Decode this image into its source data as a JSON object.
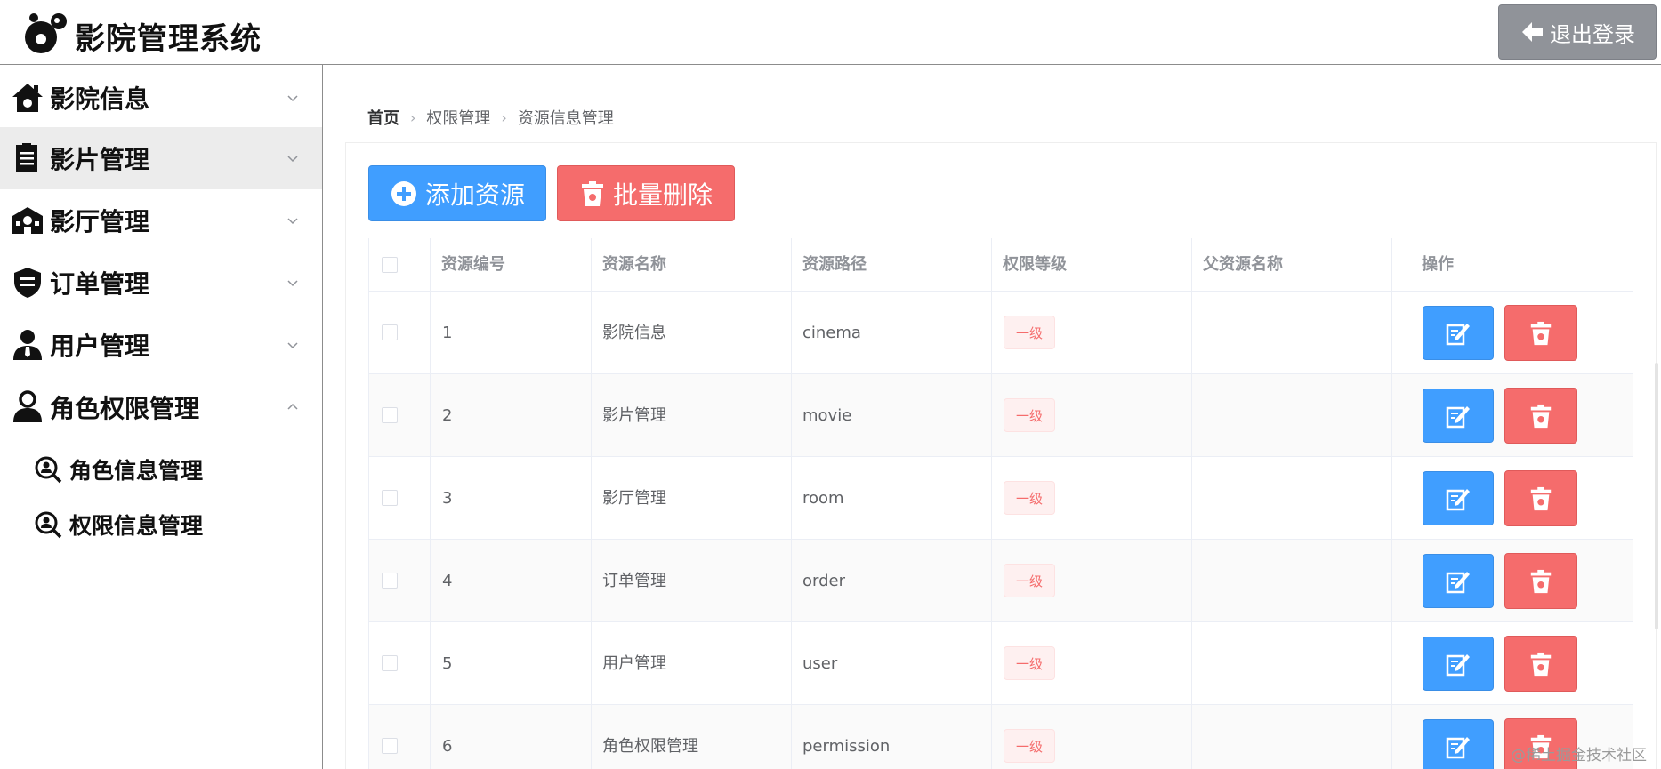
{
  "header": {
    "title": "影院管理系统",
    "logout_label": "退出登录"
  },
  "sidebar": {
    "items": [
      {
        "label": "影院信息",
        "icon": "house-icon",
        "expanded": false
      },
      {
        "label": "影片管理",
        "icon": "clipboard-icon",
        "expanded": false,
        "active": true
      },
      {
        "label": "影厅管理",
        "icon": "building-icon",
        "expanded": false
      },
      {
        "label": "订单管理",
        "icon": "shield-icon",
        "expanded": false
      },
      {
        "label": "用户管理",
        "icon": "user-tie-icon",
        "expanded": false
      },
      {
        "label": "角色权限管理",
        "icon": "user-icon",
        "expanded": true
      }
    ],
    "subitems": [
      {
        "label": "角色信息管理",
        "icon": "search-user-icon"
      },
      {
        "label": "权限信息管理",
        "icon": "search-user-icon"
      }
    ]
  },
  "breadcrumb": [
    "首页",
    "权限管理",
    "资源信息管理"
  ],
  "toolbar": {
    "add_label": "添加资源",
    "batch_delete_label": "批量删除"
  },
  "table": {
    "columns": [
      "资源编号",
      "资源名称",
      "资源路径",
      "权限等级",
      "父资源名称",
      "操作"
    ],
    "rows": [
      {
        "id": "1",
        "name": "影院信息",
        "path": "cinema",
        "level": "一级",
        "parent": ""
      },
      {
        "id": "2",
        "name": "影片管理",
        "path": "movie",
        "level": "一级",
        "parent": ""
      },
      {
        "id": "3",
        "name": "影厅管理",
        "path": "room",
        "level": "一级",
        "parent": ""
      },
      {
        "id": "4",
        "name": "订单管理",
        "path": "order",
        "level": "一级",
        "parent": ""
      },
      {
        "id": "5",
        "name": "用户管理",
        "path": "user",
        "level": "一级",
        "parent": ""
      },
      {
        "id": "6",
        "name": "角色权限管理",
        "path": "permission",
        "level": "一级",
        "parent": ""
      }
    ]
  },
  "watermark": "@稀土掘金技术社区",
  "colors": {
    "primary": "#409eff",
    "danger": "#f56c6c",
    "info": "#909399",
    "tag_bg": "#fef0f0"
  }
}
